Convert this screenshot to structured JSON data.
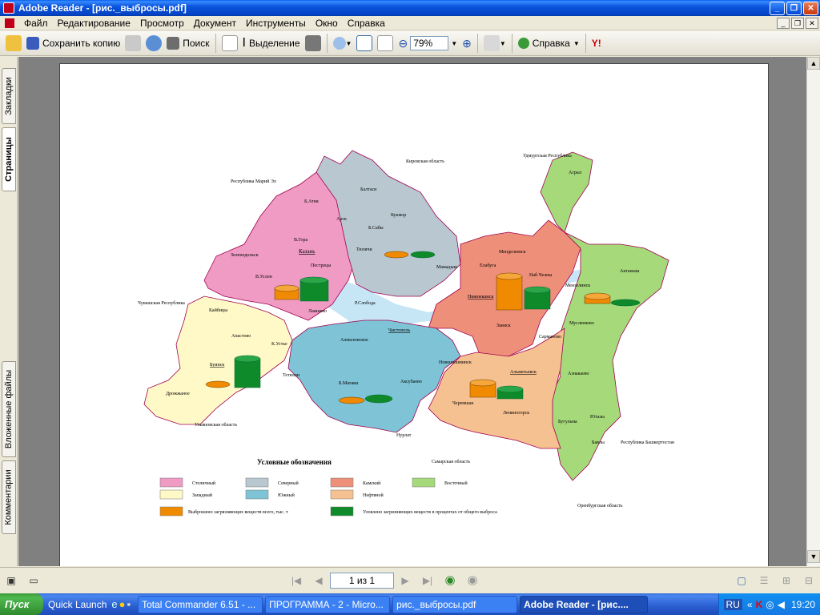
{
  "window": {
    "title": "Adobe Reader - [рис._выбросы.pdf]"
  },
  "menu": [
    "Файл",
    "Редактирование",
    "Просмотр",
    "Документ",
    "Инструменты",
    "Окно",
    "Справка"
  ],
  "toolbar": {
    "save_copy": "Сохранить копию",
    "search": "Поиск",
    "select": "Выделение",
    "zoom": "79%",
    "help": "Справка"
  },
  "sidetabs": {
    "bookmarks": "Закладки",
    "pages": "Страницы",
    "attachments": "Вложенные файлы",
    "comments": "Комментарии"
  },
  "map": {
    "outside_labels": [
      "Кировская область",
      "Республика Марий Эл",
      "Удмуртская Республика",
      "Чувашская Республика",
      "Ульяновская область",
      "Самарская область",
      "Республика Башкортостан",
      "Оренбургская область"
    ],
    "cities": [
      "Б.Атня",
      "Балтаси",
      "Арск",
      "Кукмор",
      "Б.Сабы",
      "В.Гора",
      "Казань",
      "Зеленодольск",
      "Тюлячи",
      "Пестрецы",
      "Мамадыш",
      "Менделеевск",
      "Агрыз",
      "Елабуга",
      "Наб.Челны",
      "Мензелинск",
      "Актаныш",
      "В.Услон",
      "Лаишево",
      "Р.Слобода",
      "Нижнекамск",
      "Кайбицы",
      "Апастово",
      "К.Устье",
      "Алексеевское",
      "Чистополь",
      "Заинск",
      "Сарманово",
      "Муслюмово",
      "Буинск",
      "Тетюши",
      "Новошешминск",
      "Альметьевск",
      "Азнакаево",
      "Дрожжаное",
      "Б.Матаки",
      "Аксубаево",
      "Черемшан",
      "Лениногорск",
      "Бугульма",
      "Ютазы",
      "Нурлат",
      "Бавлы"
    ],
    "legend_title": "Условные обозначения",
    "legend_regions": [
      "Столичный",
      "Северный",
      "Камский",
      "Восточный",
      "Западный",
      "Южный",
      "Нефтяной"
    ],
    "legend_bars": [
      "Выброшено загрязняющих веществ всего, тыс. т",
      "Уловлено загрязняющих веществ в процентах от общего выброса"
    ],
    "colors": {
      "stolichny": "#f09bc4",
      "severny": "#b9c8d0",
      "kamsky": "#ee8f79",
      "vostochny": "#a6d97a",
      "zapadny": "#fff9c7",
      "yuzhny": "#7fc3d6",
      "neftyanoy": "#f6c190",
      "water": "#c6e5f5",
      "emissions": "#f08a00",
      "captured": "#0e8a2a"
    }
  },
  "status": {
    "page": "1 из 1"
  },
  "taskbar": {
    "start": "Пуск",
    "quicklaunch": "Quick Launch",
    "tasks": [
      "Total Commander 6.51 - ...",
      "ПРОГРАММА - 2 - Micro...",
      "рис._выбросы.pdf",
      "Adobe Reader - [рис...."
    ],
    "lang": "RU",
    "clock": "19:20"
  }
}
